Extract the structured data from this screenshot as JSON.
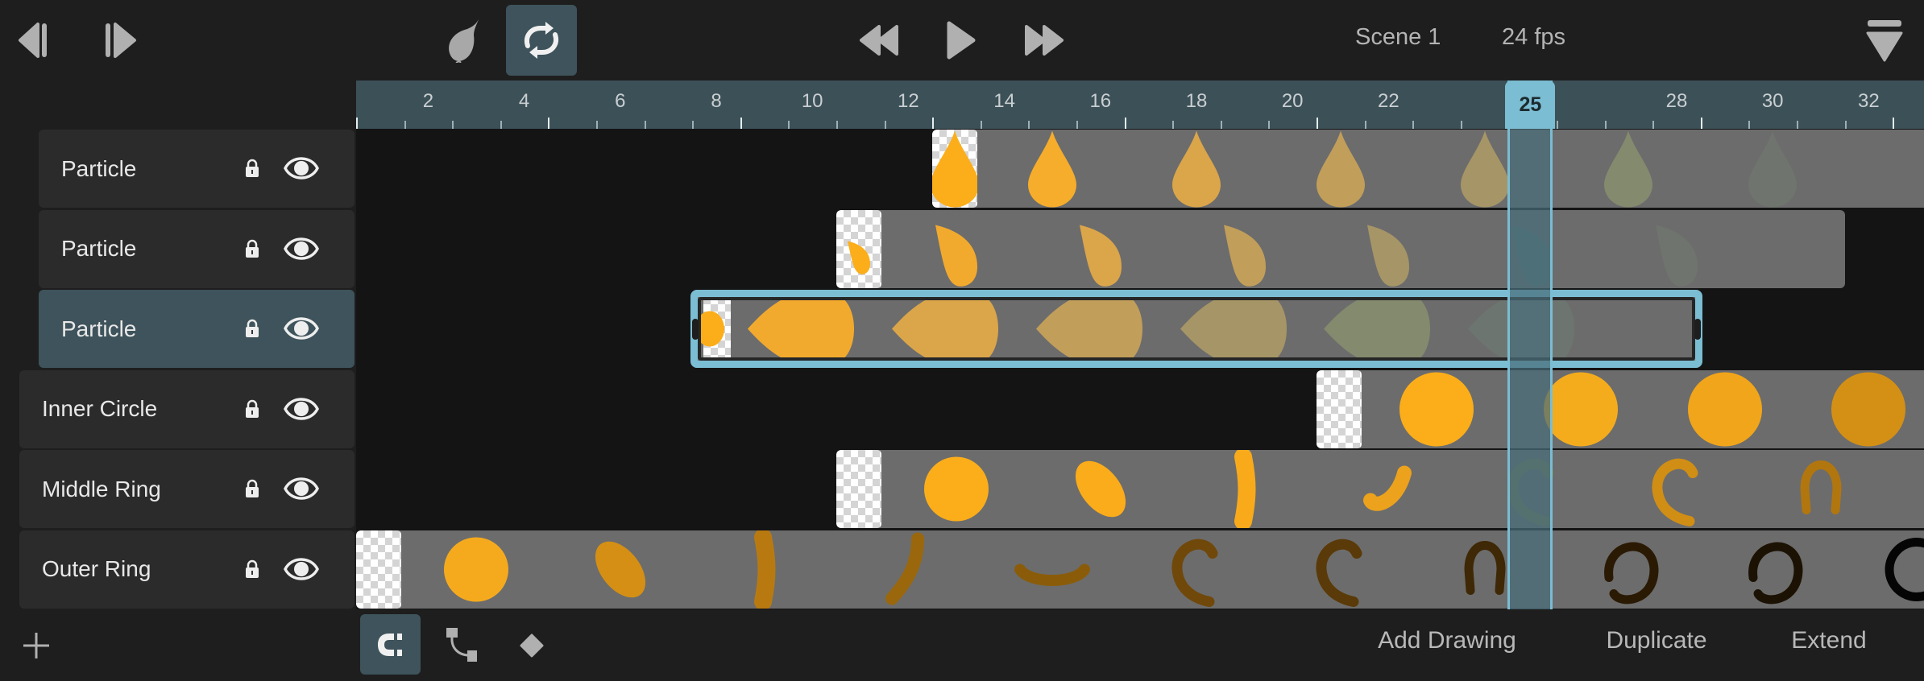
{
  "toolbar": {
    "scene": "Scene 1",
    "fps": "24 fps",
    "loop_active": true,
    "icons": [
      "step-back-icon",
      "step-forward-icon",
      "onion-skin-icon",
      "loop-icon",
      "rewind-icon",
      "play-icon",
      "fast-forward-icon",
      "dropdown-menu-icon"
    ]
  },
  "ruler": {
    "labels": [
      2,
      4,
      6,
      8,
      10,
      12,
      14,
      16,
      18,
      20,
      22,
      28,
      30,
      32
    ],
    "current_frame": "25"
  },
  "layers": [
    {
      "name": "Particle",
      "selected": false,
      "indent": true,
      "start": 13,
      "end": null,
      "key_thumb": {
        "shape": "drop-up",
        "color": "#fbae1a"
      },
      "thumbs": [
        {
          "shape": "drop-up",
          "color": "#f5ad2b"
        },
        {
          "shape": "drop-up",
          "color": "#dba54a"
        },
        {
          "shape": "drop-up",
          "color": "#c19e5a"
        },
        {
          "shape": "drop-up",
          "color": "#a69566"
        },
        {
          "shape": "drop-up",
          "color": "#838a6e"
        },
        {
          "shape": "drop-up",
          "color": "#6f746e"
        }
      ]
    },
    {
      "name": "Particle",
      "selected": false,
      "indent": true,
      "start": 11,
      "end": 31,
      "key_thumb": {
        "shape": "drop-tilt-small",
        "color": "#fbae1a"
      },
      "thumbs": [
        {
          "shape": "drop-tilt",
          "color": "#f2aa2e"
        },
        {
          "shape": "drop-tilt",
          "color": "#dba54a"
        },
        {
          "shape": "drop-tilt",
          "color": "#c19e5a"
        },
        {
          "shape": "drop-tilt",
          "color": "#a69566"
        },
        {
          "shape": "drop-tilt",
          "color": "#587272"
        },
        {
          "shape": "drop-tilt",
          "color": "#6f746e"
        }
      ]
    },
    {
      "name": "Particle",
      "selected": true,
      "indent": true,
      "start": 8,
      "end": 28,
      "key_thumb": {
        "shape": "circle-small",
        "color": "#fbae1a"
      },
      "thumbs": [
        {
          "shape": "drop-left",
          "color": "#f2aa2e"
        },
        {
          "shape": "drop-left",
          "color": "#dba54a"
        },
        {
          "shape": "drop-left",
          "color": "#c19e5a"
        },
        {
          "shape": "drop-left",
          "color": "#a69566"
        },
        {
          "shape": "drop-left",
          "color": "#838a6e"
        },
        {
          "shape": "drop-left",
          "color": "#6d7570"
        }
      ]
    },
    {
      "name": "Inner Circle",
      "selected": false,
      "indent": false,
      "start": 21,
      "end": null,
      "key_thumb": null,
      "thumbs": [
        {
          "shape": "circle-big",
          "color": "#fbae1a"
        },
        {
          "shape": "circle-big",
          "color": "#f5ac1c"
        },
        {
          "shape": "circle-big",
          "color": "#f1a51a"
        },
        {
          "shape": "circle-big",
          "color": "#d49015"
        }
      ]
    },
    {
      "name": "Middle Ring",
      "selected": false,
      "indent": false,
      "start": 11,
      "end": null,
      "key_thumb": null,
      "thumbs": [
        {
          "shape": "circle",
          "color": "#fbae1a"
        },
        {
          "shape": "blob",
          "color": "#fbac1a"
        },
        {
          "shape": "bar",
          "color": "#f9aa1a"
        },
        {
          "shape": "hook",
          "color": "#eca21c"
        },
        {
          "shape": "arc-c",
          "color": "#6f7a55"
        },
        {
          "shape": "arc-c",
          "color": "#d08e15"
        },
        {
          "shape": "horseshoe",
          "color": "#b2760f"
        }
      ]
    },
    {
      "name": "Outer Ring",
      "selected": false,
      "indent": false,
      "start": 1,
      "end": null,
      "key_thumb": null,
      "thumbs": [
        {
          "shape": "circle",
          "color": "#f5aa1e"
        },
        {
          "shape": "blob",
          "color": "#d48f14"
        },
        {
          "shape": "bar",
          "color": "#b87a10"
        },
        {
          "shape": "slash",
          "color": "#9a670c"
        },
        {
          "shape": "smile",
          "color": "#8a5c0a"
        },
        {
          "shape": "arc-c",
          "color": "#70480a"
        },
        {
          "shape": "arc-c",
          "color": "#5a3a08"
        },
        {
          "shape": "horseshoe",
          "color": "#3e2806"
        },
        {
          "shape": "ring-gap",
          "color": "#2a1a04"
        },
        {
          "shape": "ring-gap",
          "color": "#1c1204"
        },
        {
          "shape": "ring",
          "color": "#050505"
        }
      ]
    }
  ],
  "bottom": {
    "add_drawing": "Add Drawing",
    "duplicate": "Duplicate",
    "extend": "Extend",
    "snap_active": true
  },
  "colors": {
    "accent": "#7bbdd2",
    "selected_bg": "#3e535b",
    "track_bg": "#6c6c6c"
  }
}
